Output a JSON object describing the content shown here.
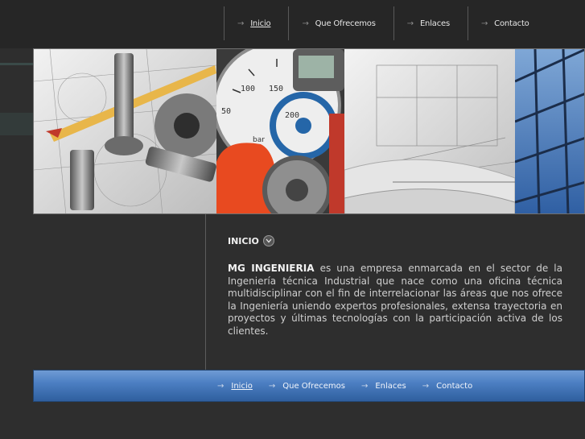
{
  "nav": [
    {
      "label": "Inicio",
      "active": true
    },
    {
      "label": "Que Ofrecemos",
      "active": false
    },
    {
      "label": "Enlaces",
      "active": false
    },
    {
      "label": "Contacto",
      "active": false
    }
  ],
  "banner": {
    "panels": [
      "engineering-drafting-tools-photo",
      "pressure-gauge-valve-photo",
      "architectural-blueprints-photo",
      "glass-building-facade-photo"
    ],
    "gauge_numbers": [
      "100",
      "150",
      "200",
      "50",
      "bar"
    ]
  },
  "main": {
    "heading": "INICIO",
    "company": "MG INGENIERIA",
    "body": " es una empresa enmarcada en el sector de la Ingeniería técnica Industrial que nace como una oficina técnica multidisciplinar con el fin de interrelacionar las áreas que nos ofrece la Ingeniería uniendo expertos profesionales, extensa trayectoria en proyectos y últimas tecnologías con la participación activa de los clientes."
  },
  "footer_nav": [
    {
      "label": "Inicio",
      "active": true
    },
    {
      "label": "Que Ofrecemos",
      "active": false
    },
    {
      "label": "Enlaces",
      "active": false
    },
    {
      "label": "Contacto",
      "active": false
    }
  ],
  "colors": {
    "background": "#2e2e2e",
    "footer_bar": "#4c7fc3",
    "accent_red": "#e84a20"
  }
}
